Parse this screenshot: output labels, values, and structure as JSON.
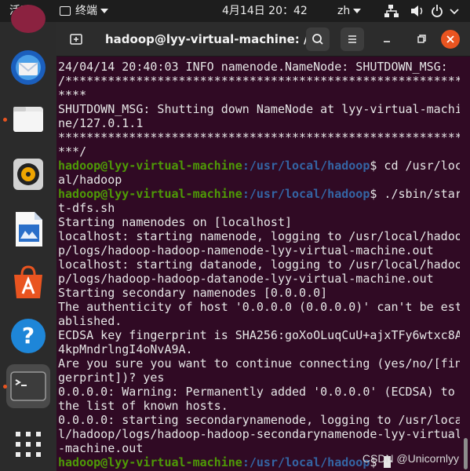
{
  "topbar": {
    "activities": "活动",
    "app_name": "终端",
    "clock": "4月14日  20：42",
    "lang": "zh"
  },
  "dock": {
    "items": [
      "thunderbird-icon",
      "files-icon",
      "rhythmbox-icon",
      "libreoffice-writer-icon",
      "ubuntu-software-icon",
      "help-icon",
      "terminal-icon",
      "show-apps-icon"
    ]
  },
  "window": {
    "title": "hadoop@lyy-virtual-machine: /..."
  },
  "terminal": {
    "lines": [
      {
        "t": "24/04/14 20:40:03 INFO namenode.NameNode: SHUTDOWN_MSG:"
      },
      {
        "t": "/************************************************************"
      },
      {
        "t": "****"
      },
      {
        "t": "SHUTDOWN_MSG: Shutting down NameNode at lyy-virtual-machi"
      },
      {
        "t": "ne/127.0.1.1"
      },
      {
        "t": "************************************************************"
      },
      {
        "t": "***/"
      },
      {
        "user": "hadoop@lyy-virtual-machine",
        "path": ":/usr/local/hadoop",
        "t": "$ cd /usr/loc"
      },
      {
        "t": "al/hadoop"
      },
      {
        "user": "hadoop@lyy-virtual-machine",
        "path": ":/usr/local/hadoop",
        "t": "$ ./sbin/star"
      },
      {
        "t": "t-dfs.sh"
      },
      {
        "t": "Starting namenodes on [localhost]"
      },
      {
        "t": "localhost: starting namenode, logging to /usr/local/hadoo"
      },
      {
        "t": "p/logs/hadoop-hadoop-namenode-lyy-virtual-machine.out"
      },
      {
        "t": "localhost: starting datanode, logging to /usr/local/hadoo"
      },
      {
        "t": "p/logs/hadoop-hadoop-datanode-lyy-virtual-machine.out"
      },
      {
        "t": "Starting secondary namenodes [0.0.0.0]"
      },
      {
        "t": "The authenticity of host '0.0.0.0 (0.0.0.0)' can't be est"
      },
      {
        "t": "ablished."
      },
      {
        "t": "ECDSA key fingerprint is SHA256:goXoOLuqCuU+ajxTFy6wtxc8A"
      },
      {
        "t": "4kpMndrlngI4oNvA9A."
      },
      {
        "t": "Are you sure you want to continue connecting (yes/no/[fin"
      },
      {
        "t": "gerprint])? yes"
      },
      {
        "t": "0.0.0.0: Warning: Permanently added '0.0.0.0' (ECDSA) to"
      },
      {
        "t": "the list of known hosts."
      },
      {
        "t": "0.0.0.0: starting secondarynamenode, logging to /usr/loca"
      },
      {
        "t": "l/hadoop/logs/hadoop-hadoop-secondarynamenode-lyy-virtual"
      },
      {
        "t": "-machine.out"
      },
      {
        "user": "hadoop@lyy-virtual-machine",
        "path": ":/usr/local/hadoop",
        "t": "$ "
      }
    ]
  },
  "watermark": "CSDN @Unicornlyy"
}
